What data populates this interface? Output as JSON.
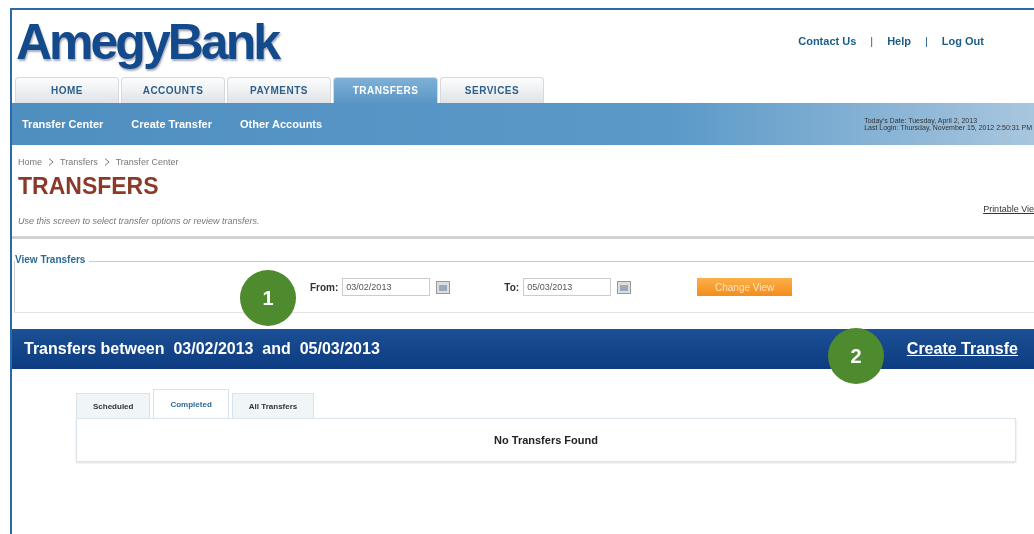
{
  "logo": "AmegyBank",
  "top_links": [
    {
      "kind": "link",
      "text": "Contact Us"
    },
    {
      "kind": "separator",
      "text": "|"
    },
    {
      "kind": "link",
      "text": "Help"
    },
    {
      "kind": "separator",
      "text": "|"
    },
    {
      "kind": "link",
      "text": "Log Out"
    }
  ],
  "tabs": [
    {
      "label": "HOME",
      "selected": false
    },
    {
      "label": "ACCOUNTS",
      "selected": false
    },
    {
      "label": "PAYMENTS",
      "selected": false
    },
    {
      "label": "TRANSFERS",
      "selected": true
    },
    {
      "label": "SERVICES",
      "selected": false
    }
  ],
  "subnav": [
    "Transfer Center",
    "Create Transfer",
    "Other Accounts"
  ],
  "session": [
    "Today's Date: Tuesday, April 2, 2013",
    "Last Login: Thursday, November 15, 2012 2:50:31 PM"
  ],
  "breadcrumb": [
    "Home",
    "Transfers",
    "Transfer Center"
  ],
  "title": "TRANSFERS",
  "description": "Use this screen to select transfer options or review transfers.",
  "printable_link": "Printable Vie",
  "view_transfers": {
    "legend": "View Transfers",
    "from_label": "From:",
    "from_value": "03/02/2013",
    "to_label": "To:",
    "to_value": "05/03/2013",
    "button": "Change View"
  },
  "results_bar": {
    "title": "Transfers between  03/02/2013  and  05/03/2013",
    "link": "Create Transfe"
  },
  "result_tabs": [
    {
      "label": "Scheduled",
      "selected": false
    },
    {
      "label": "Completed",
      "selected": true
    },
    {
      "label": "All Transfers",
      "selected": false
    }
  ],
  "empty_message": "No Transfers Found",
  "callouts": [
    "1",
    "2"
  ]
}
